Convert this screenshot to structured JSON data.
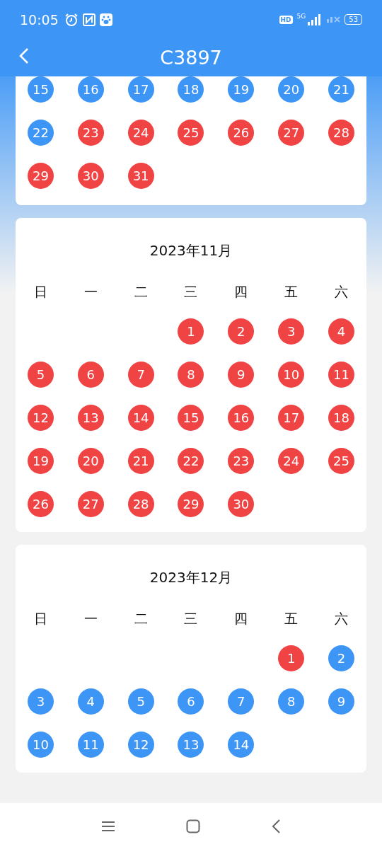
{
  "status_bar": {
    "time": "10:05",
    "hd": "HD",
    "network": "5G",
    "battery": "53"
  },
  "header": {
    "title": "C3897"
  },
  "months": [
    {
      "weeks": [
        [
          {
            "kind": "day",
            "day": "15",
            "color": "#3d95f5"
          },
          {
            "kind": "day",
            "day": "16",
            "color": "#3d95f5"
          },
          {
            "kind": "day",
            "day": "17",
            "color": "#3d95f5"
          },
          {
            "kind": "day",
            "day": "18",
            "color": "#3d95f5"
          },
          {
            "kind": "day",
            "day": "19",
            "color": "#3d95f5"
          },
          {
            "kind": "day",
            "day": "20",
            "color": "#3d95f5"
          },
          {
            "kind": "day",
            "day": "21",
            "color": "#3d95f5"
          }
        ],
        [
          {
            "kind": "day",
            "day": "22",
            "color": "#3d95f5"
          },
          {
            "kind": "day",
            "day": "23",
            "color": "#f04444"
          },
          {
            "kind": "day",
            "day": "24",
            "color": "#f04444"
          },
          {
            "kind": "day",
            "day": "25",
            "color": "#f04444"
          },
          {
            "kind": "day",
            "day": "26",
            "color": "#f04444"
          },
          {
            "kind": "day",
            "day": "27",
            "color": "#f04444"
          },
          {
            "kind": "day",
            "day": "28",
            "color": "#f04444"
          }
        ],
        [
          {
            "kind": "day",
            "day": "29",
            "color": "#f04444"
          },
          {
            "kind": "day",
            "day": "30",
            "color": "#f04444"
          },
          {
            "kind": "day",
            "day": "31",
            "color": "#f04444"
          }
        ]
      ]
    },
    {
      "title": "2023年11月",
      "weekdays": [
        "日",
        "一",
        "二",
        "三",
        "四",
        "五",
        "六"
      ],
      "weeks": [
        [
          {
            "kind": "blank"
          },
          {
            "kind": "blank"
          },
          {
            "kind": "blank"
          },
          {
            "kind": "day",
            "day": "1",
            "color": "#f04444"
          },
          {
            "kind": "day",
            "day": "2",
            "color": "#f04444"
          },
          {
            "kind": "day",
            "day": "3",
            "color": "#f04444"
          },
          {
            "kind": "day",
            "day": "4",
            "color": "#f04444"
          }
        ],
        [
          {
            "kind": "day",
            "day": "5",
            "color": "#f04444"
          },
          {
            "kind": "day",
            "day": "6",
            "color": "#f04444"
          },
          {
            "kind": "day",
            "day": "7",
            "color": "#f04444"
          },
          {
            "kind": "day",
            "day": "8",
            "color": "#f04444"
          },
          {
            "kind": "day",
            "day": "9",
            "color": "#f04444"
          },
          {
            "kind": "day",
            "day": "10",
            "color": "#f04444"
          },
          {
            "kind": "day",
            "day": "11",
            "color": "#f04444"
          }
        ],
        [
          {
            "kind": "day",
            "day": "12",
            "color": "#f04444"
          },
          {
            "kind": "day",
            "day": "13",
            "color": "#f04444"
          },
          {
            "kind": "day",
            "day": "14",
            "color": "#f04444"
          },
          {
            "kind": "day",
            "day": "15",
            "color": "#f04444"
          },
          {
            "kind": "day",
            "day": "16",
            "color": "#f04444"
          },
          {
            "kind": "day",
            "day": "17",
            "color": "#f04444"
          },
          {
            "kind": "day",
            "day": "18",
            "color": "#f04444"
          }
        ],
        [
          {
            "kind": "day",
            "day": "19",
            "color": "#f04444"
          },
          {
            "kind": "day",
            "day": "20",
            "color": "#f04444"
          },
          {
            "kind": "day",
            "day": "21",
            "color": "#f04444"
          },
          {
            "kind": "day",
            "day": "22",
            "color": "#f04444"
          },
          {
            "kind": "day",
            "day": "23",
            "color": "#f04444"
          },
          {
            "kind": "day",
            "day": "24",
            "color": "#f04444"
          },
          {
            "kind": "day",
            "day": "25",
            "color": "#f04444"
          }
        ],
        [
          {
            "kind": "day",
            "day": "26",
            "color": "#f04444"
          },
          {
            "kind": "day",
            "day": "27",
            "color": "#f04444"
          },
          {
            "kind": "day",
            "day": "28",
            "color": "#f04444"
          },
          {
            "kind": "day",
            "day": "29",
            "color": "#f04444"
          },
          {
            "kind": "day",
            "day": "30",
            "color": "#f04444"
          }
        ]
      ]
    },
    {
      "title": "2023年12月",
      "weekdays": [
        "日",
        "一",
        "二",
        "三",
        "四",
        "五",
        "六"
      ],
      "weeks": [
        [
          {
            "kind": "blank"
          },
          {
            "kind": "blank"
          },
          {
            "kind": "blank"
          },
          {
            "kind": "blank"
          },
          {
            "kind": "blank"
          },
          {
            "kind": "day",
            "day": "1",
            "color": "#f04444"
          },
          {
            "kind": "day",
            "day": "2",
            "color": "#3d95f5"
          }
        ],
        [
          {
            "kind": "day",
            "day": "3",
            "color": "#3d95f5"
          },
          {
            "kind": "day",
            "day": "4",
            "color": "#3d95f5"
          },
          {
            "kind": "day",
            "day": "5",
            "color": "#3d95f5"
          },
          {
            "kind": "day",
            "day": "6",
            "color": "#3d95f5"
          },
          {
            "kind": "day",
            "day": "7",
            "color": "#3d95f5"
          },
          {
            "kind": "day",
            "day": "8",
            "color": "#3d95f5"
          },
          {
            "kind": "day",
            "day": "9",
            "color": "#3d95f5"
          }
        ],
        [
          {
            "kind": "day",
            "day": "10",
            "color": "#3d95f5"
          },
          {
            "kind": "day",
            "day": "11",
            "color": "#3d95f5"
          },
          {
            "kind": "day",
            "day": "12",
            "color": "#3d95f5"
          },
          {
            "kind": "day",
            "day": "13",
            "color": "#3d95f5"
          },
          {
            "kind": "day",
            "day": "14",
            "color": "#3d95f5"
          }
        ]
      ]
    }
  ]
}
